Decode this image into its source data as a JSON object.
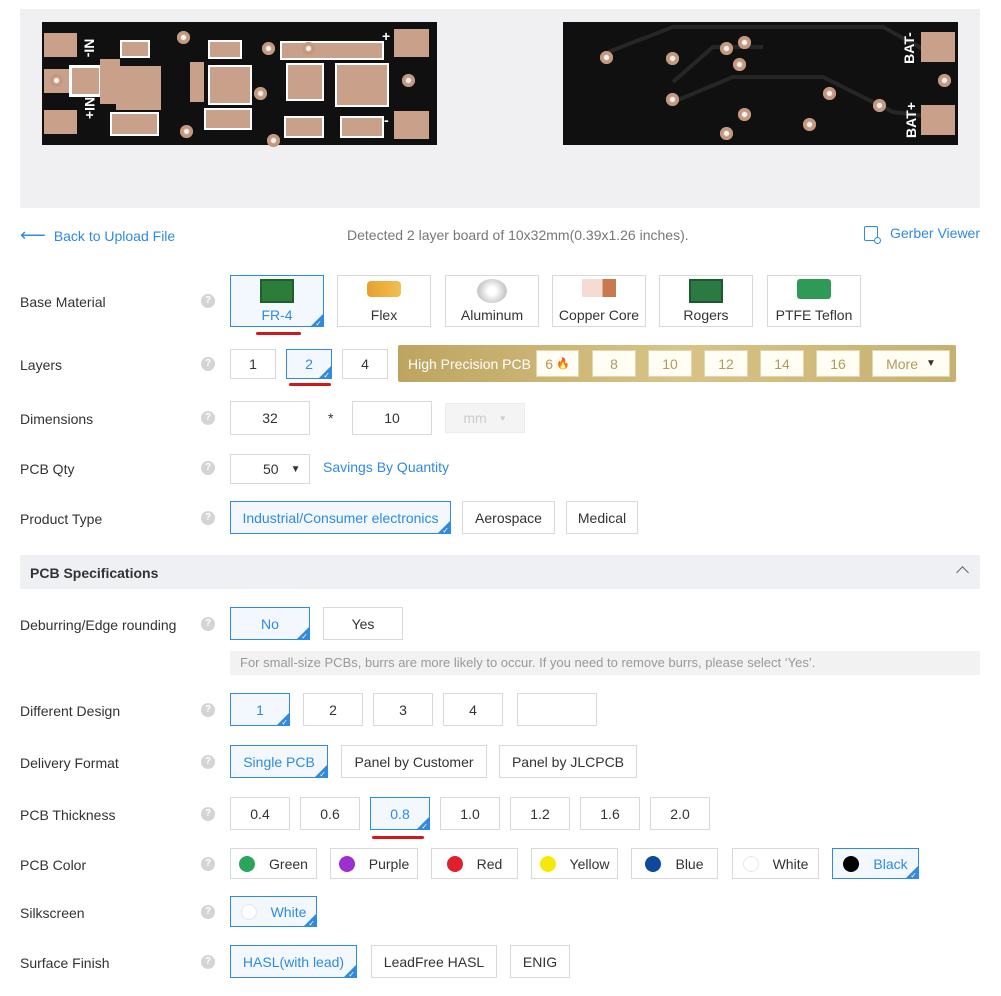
{
  "preview": {
    "top_labels": [
      "NI-",
      "+",
      "NI+",
      "-"
    ],
    "bottom_labels": [
      "BAT-",
      "BAT+"
    ]
  },
  "toolbar": {
    "back_label": "Back to Upload File",
    "detected_text": "Detected 2 layer board of 10x32mm(0.39x1.26 inches).",
    "gerber_label": "Gerber Viewer"
  },
  "help_glyph": "?",
  "base_material": {
    "label": "Base Material",
    "options": [
      "FR-4",
      "Flex",
      "Aluminum",
      "Copper Core",
      "Rogers",
      "PTFE Teflon"
    ],
    "selected": "FR-4"
  },
  "layers": {
    "label": "Layers",
    "options": [
      "1",
      "2",
      "4"
    ],
    "selected": "2",
    "high_precision_label": "High Precision PCB",
    "hp_options": [
      "6",
      "8",
      "10",
      "12",
      "14",
      "16"
    ],
    "more_label": "More"
  },
  "dimensions": {
    "label": "Dimensions",
    "length": "32",
    "width": "10",
    "separator": "*",
    "unit": "mm"
  },
  "pcb_qty": {
    "label": "PCB Qty",
    "value": "50",
    "savings_link": "Savings By Quantity"
  },
  "product_type": {
    "label": "Product Type",
    "options": [
      "Industrial/Consumer electronics",
      "Aerospace",
      "Medical"
    ],
    "selected": "Industrial/Consumer electronics"
  },
  "section": {
    "title": "PCB Specifications"
  },
  "deburring": {
    "label": "Deburring/Edge rounding",
    "options": [
      "No",
      "Yes"
    ],
    "selected": "No",
    "note": "For small-size PCBs, burrs are more likely to occur. If you need to remove burrs, please select ‘Yes’."
  },
  "different_design": {
    "label": "Different Design",
    "options": [
      "1",
      "2",
      "3",
      "4"
    ],
    "custom_value": "",
    "selected": "1"
  },
  "delivery_format": {
    "label": "Delivery Format",
    "options": [
      "Single PCB",
      "Panel by Customer",
      "Panel by JLCPCB"
    ],
    "selected": "Single PCB"
  },
  "thickness": {
    "label": "PCB Thickness",
    "options": [
      "0.4",
      "0.6",
      "0.8",
      "1.0",
      "1.2",
      "1.6",
      "2.0"
    ],
    "selected": "0.8"
  },
  "pcb_color": {
    "label": "PCB Color",
    "options": [
      {
        "name": "Green",
        "hex": "#2aa55a"
      },
      {
        "name": "Purple",
        "hex": "#9b2fcf"
      },
      {
        "name": "Red",
        "hex": "#e0202a"
      },
      {
        "name": "Yellow",
        "hex": "#f5e90a"
      },
      {
        "name": "Blue",
        "hex": "#0d4a9a"
      },
      {
        "name": "White",
        "hex": "#ffffff"
      },
      {
        "name": "Black",
        "hex": "#000000"
      }
    ],
    "selected": "Black"
  },
  "silkscreen": {
    "label": "Silkscreen",
    "options": [
      {
        "name": "White",
        "hex": "#ffffff"
      }
    ],
    "selected": "White"
  },
  "surface_finish": {
    "label": "Surface Finish",
    "options": [
      "HASL(with lead)",
      "LeadFree HASL",
      "ENIG"
    ],
    "selected": "HASL(with lead)"
  },
  "colors": {
    "accent": "#2f8ae0",
    "gold": "#c9b577",
    "annotation_red": "#d3171b"
  }
}
